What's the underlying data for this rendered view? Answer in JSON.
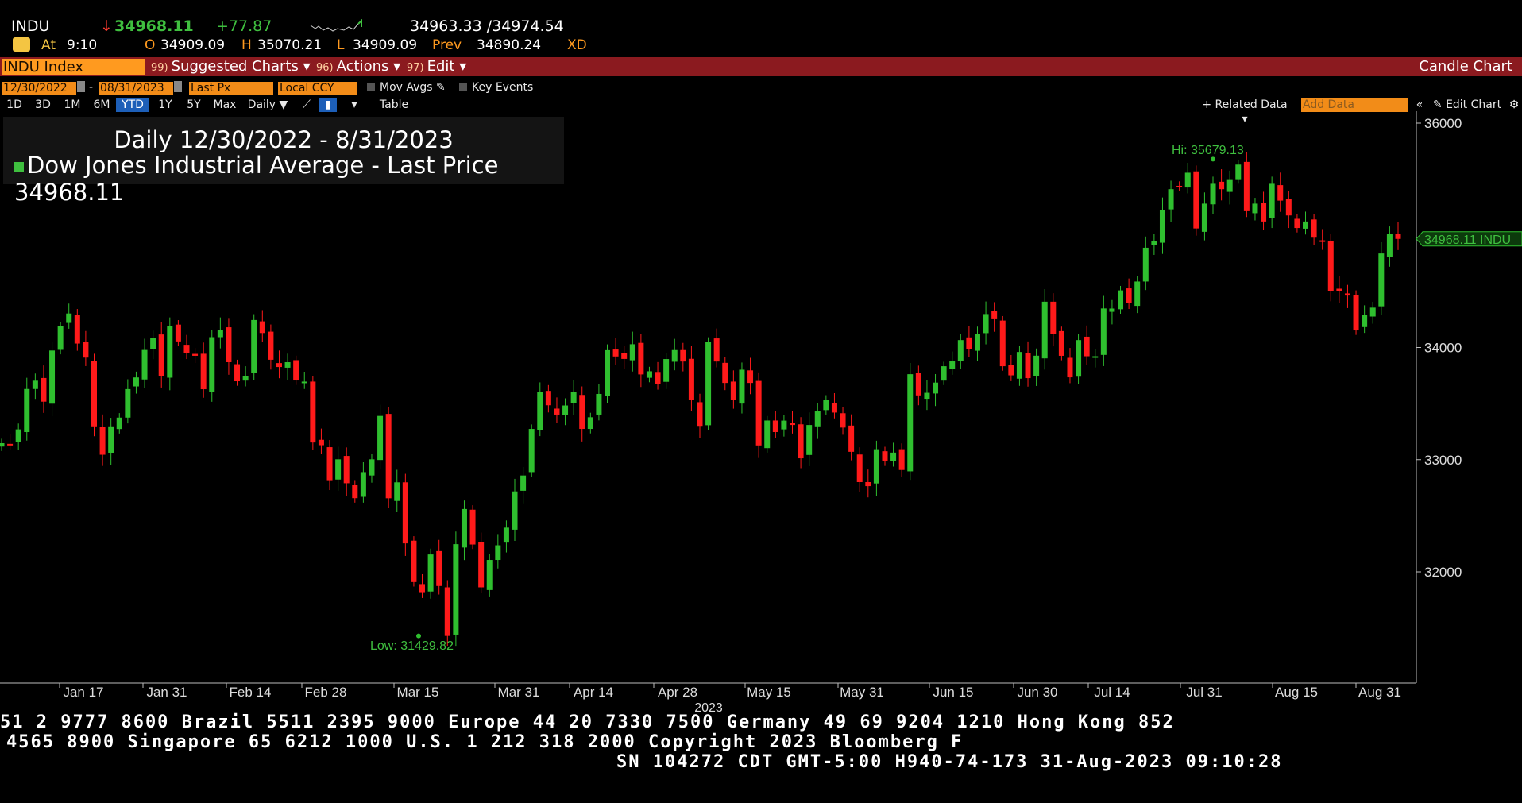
{
  "quote": {
    "ticker": "INDU",
    "down_arrow": "↓",
    "last": "34968.11",
    "change": "+77.87",
    "bid_ask": "34963.33 /34974.54",
    "at_label": "At",
    "time": "9:10",
    "open_label": "O",
    "open": "34909.09",
    "high_label": "H",
    "high": "35070.21",
    "low_label": "L",
    "low": "34909.09",
    "prev_label": "Prev",
    "prev": "34890.24",
    "xd": "XD"
  },
  "menubar": {
    "index_box": "INDU Index",
    "suggested_num": "99)",
    "suggested": "Suggested Charts ▾",
    "actions_num": "96)",
    "actions": "Actions ▾",
    "edit_num": "97)",
    "edit": "Edit ▾",
    "chart_type": "Candle Chart"
  },
  "toolbar": {
    "start_date": "12/30/2022",
    "dash": "-",
    "end_date": "08/31/2023",
    "field": "Last Px",
    "currency": "Local CCY",
    "mov_avgs": "Mov Avgs",
    "key_events": "Key Events",
    "periods": [
      "1D",
      "3D",
      "1M",
      "6M",
      "YTD",
      "1Y",
      "5Y",
      "Max"
    ],
    "active_period": "YTD",
    "frequency": "Daily ▼",
    "table": "Table",
    "related_data": "+ Related Data ▾",
    "add_data_placeholder": "Add Data",
    "collapse": "«",
    "edit_chart": "Edit Chart"
  },
  "legend": {
    "line1": "Daily 12/30/2022 - 8/31/2023",
    "line2": "Dow Jones Industrial Average - Last Price",
    "value": "34968.11"
  },
  "colors": {
    "up": "#2fbf2f",
    "down": "#ff1a1a",
    "accent_orange": "#f28c18",
    "menubar_red": "#8b1a1f",
    "label_green": "#3fbf3f"
  },
  "chart_data": {
    "type": "candlestick",
    "ylim": [
      31000,
      36000
    ],
    "yticks": [
      36000,
      34000,
      33000,
      32000
    ],
    "xtick_labels": [
      "Jan 17",
      "Jan 31",
      "Feb 14",
      "Feb 28",
      "Mar 15",
      "Mar 31",
      "Apr 14",
      "Apr 28",
      "May 15",
      "May 31",
      "Jun 15",
      "Jun 30",
      "Jul 14",
      "Jul 31",
      "Aug 15",
      "Aug 31"
    ],
    "x_year_label": "2023",
    "high_label": "Hi: 35679.13",
    "low_label": "Low: 31429.82",
    "last_label": "34968.11 INDU",
    "closes": [
      33147,
      33136,
      33270,
      33630,
      33704,
      33517,
      33973,
      34189,
      34303,
      34035,
      33910,
      33297,
      33044,
      33297,
      33375,
      33629,
      33733,
      33978,
      34086,
      33743,
      34192,
      34054,
      33949,
      33926,
      33628,
      34092,
      34156,
      33869,
      33699,
      33745,
      34245,
      34129,
      33891,
      33826,
      33869,
      33706,
      33696,
      33153,
      33129,
      32817,
      33003,
      32790,
      32657,
      32889,
      33003,
      33390,
      32656,
      32798,
      32254,
      31909,
      31819,
      32155,
      31874,
      31429,
      32247,
      32560,
      32244,
      31862,
      32106,
      32237,
      32394,
      32717,
      32859,
      33274,
      33601,
      33485,
      33402,
      33483,
      33601,
      33274,
      33378,
      33586,
      33976,
      33920,
      33898,
      34029,
      33760,
      33788,
      33676,
      33897,
      33977,
      33875,
      33530,
      33301,
      34051,
      33875,
      33684,
      33530,
      33802,
      33684,
      33127,
      33349,
      33246,
      33348,
      33309,
      33012,
      33309,
      33430,
      33535,
      33420,
      33286,
      33070,
      32800,
      32764,
      33093,
      32984,
      33063,
      32908,
      33762,
      33573,
      33596,
      33687,
      33833,
      33876,
      34066,
      33989,
      34122,
      34298,
      34252,
      33833,
      33752,
      33960,
      33727,
      33927,
      34408,
      34122,
      33926,
      33734,
      34066,
      33922,
      33922,
      34348,
      34347,
      34509,
      34395,
      34588,
      34889,
      34952,
      35225,
      35411,
      35438,
      35558,
      35061,
      35282,
      35459,
      35411,
      35500,
      35630,
      35215,
      35282,
      35123,
      35459,
      35309,
      35177,
      35065,
      35123,
      34979,
      34946,
      34500,
      34500,
      34463,
      34152,
      34288,
      34355,
      34838,
      35015,
      34968
    ]
  }
}
